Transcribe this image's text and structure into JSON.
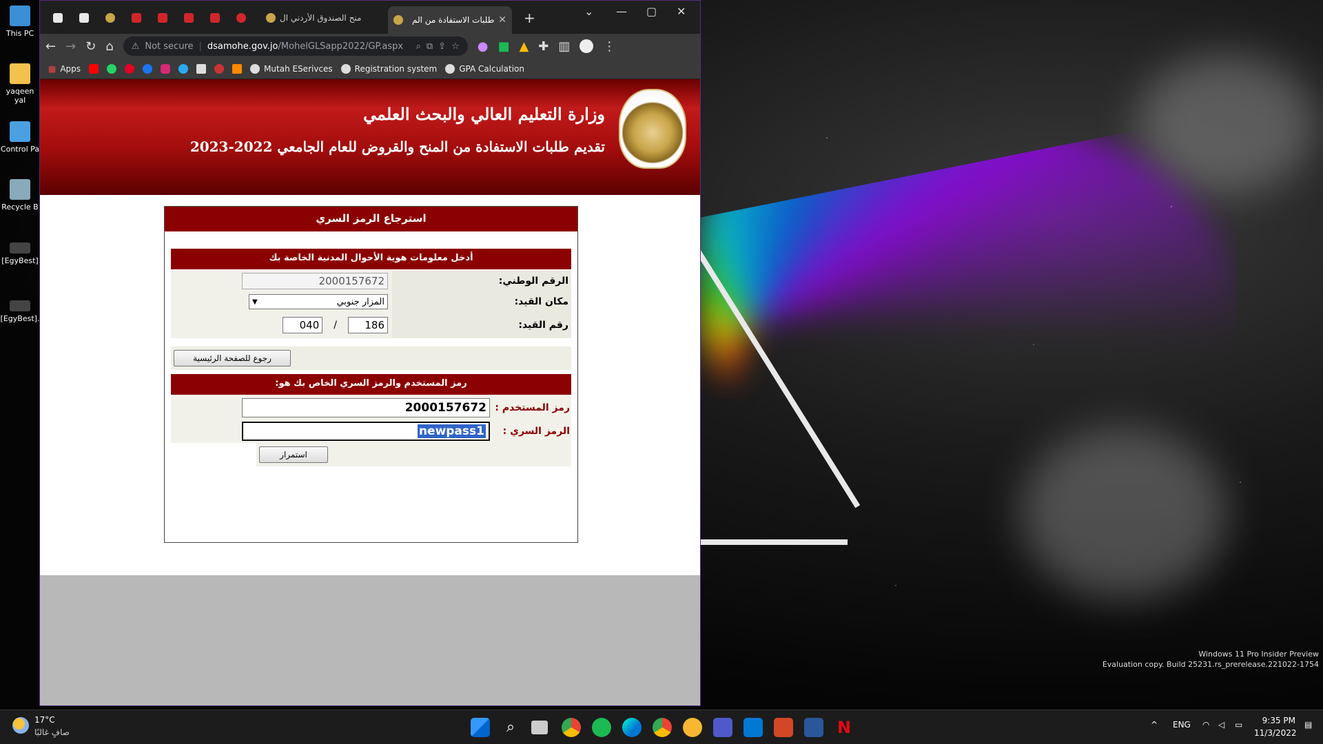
{
  "desktop": {
    "icons": [
      {
        "label": "This PC",
        "color": "#3b8fd6"
      },
      {
        "label": "yaqeen yal",
        "color": "#f2c14e"
      },
      {
        "label": "Control Pa",
        "color": "#4aa0e0"
      },
      {
        "label": "Recycle B",
        "color": "#8ab"
      },
      {
        "label": "[EgyBest]",
        "color": "#444"
      },
      {
        "label": "[EgyBest].",
        "color": "#444"
      }
    ],
    "watermark_line1": "Windows 11 Pro Insider Preview",
    "watermark_line2": "Evaluation copy. Build 25231.rs_prerelease.221022-1754"
  },
  "browser": {
    "tabs": [
      {
        "title": "منح الصندوق الأردني ال",
        "icon": "crest"
      },
      {
        "title": "طلبات الاستفادة من الم",
        "icon": "crest"
      }
    ],
    "new_tab": "+",
    "url_security": "Not secure",
    "url_host": "dsamohe.gov.jo",
    "url_path": "/MohelGLSapp2022/GP.aspx",
    "bookmarks": [
      {
        "label": "Apps",
        "color": "#e44"
      },
      {
        "label": "Mutah ESerivces",
        "color": "#ddd"
      },
      {
        "label": "Registration system",
        "color": "#ddd"
      },
      {
        "label": "GPA Calculation",
        "color": "#ddd"
      }
    ]
  },
  "page": {
    "title1": "وزارة التعليم العالي والبحث العلمي",
    "title2": "تقديم طلبات الاستفادة من المنح والقروض للعام الجامعي 2022-2023",
    "panel_title": "استرجاع الرمز السري",
    "section1": "أدخل معلومات هوية الأحوال المدنية الخاصة بك",
    "national_id_label": "الرقم الوطني:",
    "national_id_value": "2000157672",
    "reg_place_label": "مكان القيد:",
    "reg_place_value": "المزار جنوبي",
    "reg_no_label": "رقم القيد:",
    "reg_no_a": "186",
    "reg_no_sep": "/",
    "reg_no_b": "040",
    "back_button": "رجوع للصفحة الرئيسية",
    "section2": "رمز المستخدم والرمز السري الخاص بك هو:",
    "username_label": "رمز المستخدم :",
    "username_value": "2000157672",
    "password_label": "الرمز السري :",
    "password_value": "newpass1",
    "continue_button": "استمرار"
  },
  "taskbar": {
    "weather_temp": "17°C",
    "weather_desc": "صافٍ غالبًا",
    "lang": "ENG",
    "time": "9:35 PM",
    "date": "11/3/2022"
  }
}
